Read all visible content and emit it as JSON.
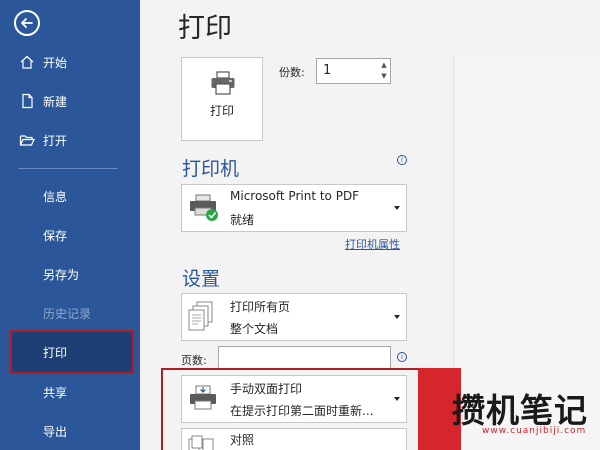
{
  "sidebar": {
    "items": [
      {
        "label": "开始"
      },
      {
        "label": "新建"
      },
      {
        "label": "打开"
      },
      {
        "label": "信息"
      },
      {
        "label": "保存"
      },
      {
        "label": "另存为"
      },
      {
        "label": "历史记录"
      },
      {
        "label": "打印"
      },
      {
        "label": "共享"
      },
      {
        "label": "导出"
      }
    ]
  },
  "main": {
    "title": "打印",
    "print_button_label": "打印",
    "copies_label": "份数:",
    "copies_value": "1",
    "printer_section_title": "打印机",
    "printer": {
      "name": "Microsoft Print to PDF",
      "status": "就绪"
    },
    "printer_properties_link": "打印机属性",
    "settings_section_title": "设置",
    "print_range": {
      "main": "打印所有页",
      "sub": "整个文档"
    },
    "pages_label": "页数:",
    "pages_value": "",
    "duplex": {
      "main": "手动双面打印",
      "sub": "在提示打印第二面时重新..."
    },
    "collate": {
      "main": "对照"
    },
    "info_symbol": "i"
  },
  "watermark": {
    "text": "攒机笔记",
    "url": "www.cuanjibiji.com"
  },
  "colors": {
    "sidebar": "#2b579a",
    "sidebar_active": "#1e3f75",
    "highlight_outline": "#b01e23",
    "accent": "#2b579a"
  }
}
